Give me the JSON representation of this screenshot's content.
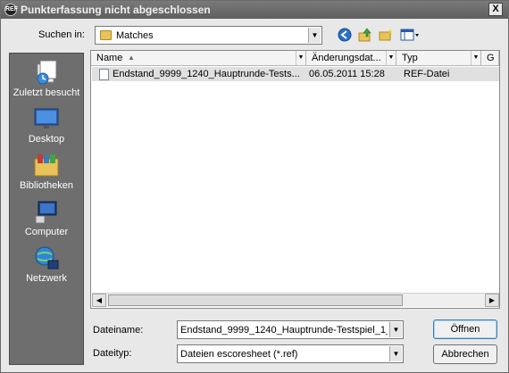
{
  "window": {
    "title": "Punkterfassung nicht abgeschlossen",
    "close_glyph": "X",
    "app_icon_text": "REF"
  },
  "toolbar": {
    "look_in_label": "Suchen in:",
    "look_in_value": "Matches",
    "icons": [
      "back-icon",
      "up-folder-icon",
      "new-folder-icon",
      "view-menu-icon"
    ]
  },
  "places": [
    {
      "label": "Zuletzt besucht",
      "icon": "recent-icon"
    },
    {
      "label": "Desktop",
      "icon": "desktop-icon"
    },
    {
      "label": "Bibliotheken",
      "icon": "libraries-icon"
    },
    {
      "label": "Computer",
      "icon": "computer-icon"
    },
    {
      "label": "Netzwerk",
      "icon": "network-icon"
    }
  ],
  "list": {
    "columns": [
      {
        "label": "Name"
      },
      {
        "label": "Änderungsdat..."
      },
      {
        "label": "Typ"
      },
      {
        "label": "G"
      }
    ],
    "rows": [
      {
        "name": "Endstand_9999_1240_Hauptrunde-Tests...",
        "modified": "06.05.2011 15:28",
        "type": "REF-Datei"
      }
    ]
  },
  "filename": {
    "label": "Dateiname:",
    "value": "Endstand_9999_1240_Hauptrunde-Testspiel_1_"
  },
  "filetype": {
    "label": "Dateityp:",
    "value": "Dateien escoresheet (*.ref)"
  },
  "buttons": {
    "open": "Öffnen",
    "cancel": "Abbrechen"
  },
  "colors": {
    "accent": "#3c7fb1",
    "places_bg": "#6e6e6e",
    "selected_row": "#e0e0e0"
  }
}
